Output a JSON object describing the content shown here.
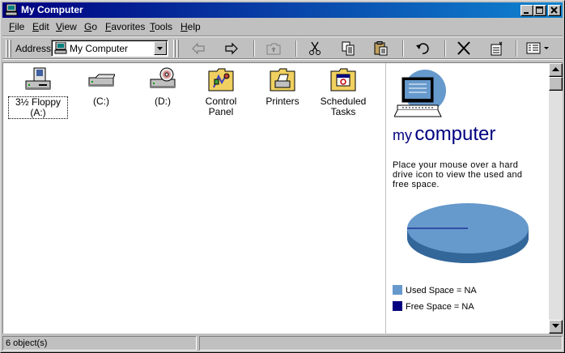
{
  "window": {
    "title": "My Computer",
    "title_gradient": [
      "#000080",
      "#1084d0"
    ]
  },
  "menu": {
    "items": [
      {
        "label": "File",
        "underline": "F",
        "rest": "ile"
      },
      {
        "label": "Edit",
        "underline": "E",
        "rest": "dit"
      },
      {
        "label": "View",
        "underline": "V",
        "rest": "iew"
      },
      {
        "label": "Go",
        "underline": "G",
        "rest": "o"
      },
      {
        "label": "Favorites",
        "underline": "F",
        "rest": "avorites",
        "pre": ""
      },
      {
        "label": "Tools",
        "underline": "T",
        "rest": "ools"
      },
      {
        "label": "Help",
        "underline": "H",
        "rest": "elp"
      }
    ]
  },
  "toolbar": {
    "address_label": "Address",
    "address_value": "My Computer",
    "buttons": [
      "back-icon",
      "forward-icon",
      "up-folder-icon",
      "cut-icon",
      "copy-icon",
      "paste-icon",
      "undo-icon",
      "delete-icon",
      "properties-icon",
      "views-icon"
    ]
  },
  "items": [
    {
      "label": "3½ Floppy (A:)",
      "icon": "floppy-drive-icon",
      "selected": true
    },
    {
      "label": "(C:)",
      "icon": "hard-drive-icon",
      "selected": false
    },
    {
      "label": "(D:)",
      "icon": "cd-drive-icon",
      "selected": false
    },
    {
      "label": "Control Panel",
      "icon": "control-panel-icon",
      "selected": false
    },
    {
      "label": "Printers",
      "icon": "printers-icon",
      "selected": false
    },
    {
      "label": "Scheduled Tasks",
      "icon": "scheduled-tasks-icon",
      "selected": false
    }
  ],
  "info": {
    "title_my": "my",
    "title_computer": "computer",
    "description": "Place your mouse over a hard drive icon to view the used and free space.",
    "legend": [
      {
        "label": "Used Space = NA",
        "color": "#6699cc"
      },
      {
        "label": "Free Space = NA",
        "color": "#000080"
      }
    ]
  },
  "status": {
    "text": "6 object(s)"
  }
}
